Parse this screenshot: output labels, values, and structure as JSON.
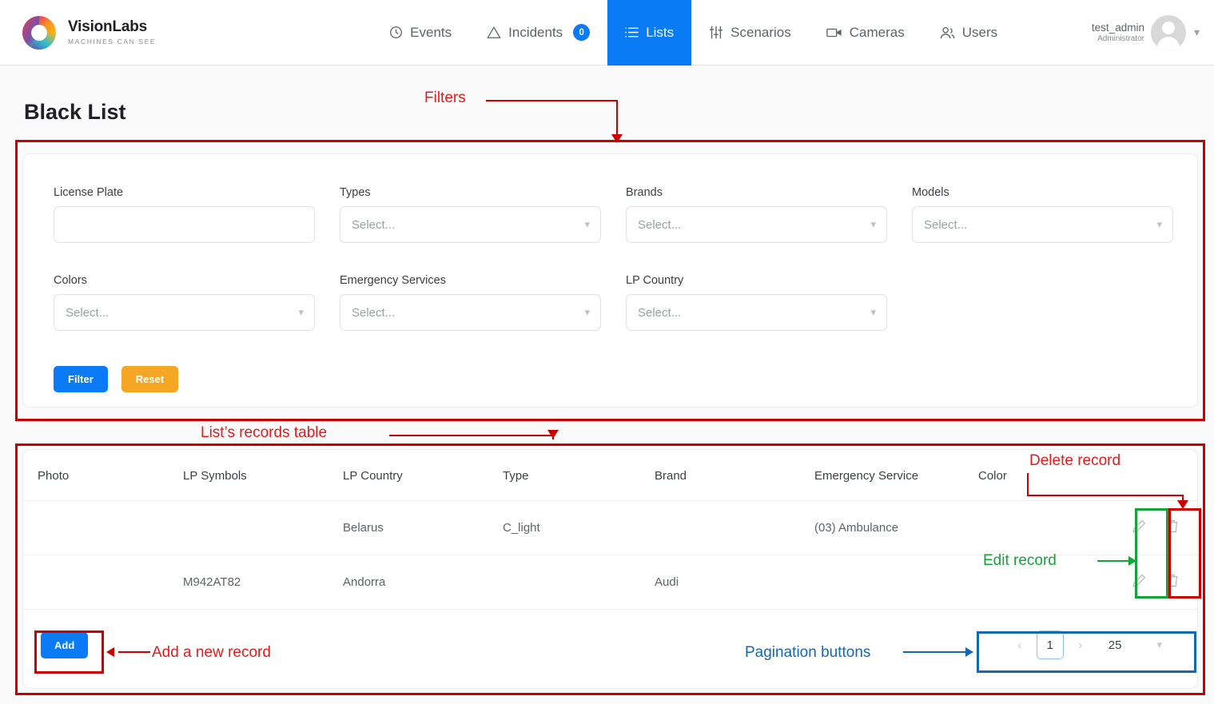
{
  "brand": {
    "name": "VisionLabs",
    "tagline": "MACHINES CAN SEE"
  },
  "nav": {
    "items": [
      {
        "label": "Events",
        "icon": "clock-icon",
        "active": false
      },
      {
        "label": "Incidents",
        "icon": "warning-triangle-icon",
        "active": false,
        "badge": "0"
      },
      {
        "label": "Lists",
        "icon": "list-icon",
        "active": true
      },
      {
        "label": "Scenarios",
        "icon": "sliders-icon",
        "active": false
      },
      {
        "label": "Cameras",
        "icon": "video-camera-icon",
        "active": false
      },
      {
        "label": "Users",
        "icon": "users-icon",
        "active": false
      }
    ],
    "user": {
      "name": "test_admin",
      "role": "Administrator"
    }
  },
  "page": {
    "title": "Black List"
  },
  "filters": {
    "license_plate": {
      "label": "License Plate",
      "value": "",
      "placeholder": ""
    },
    "types": {
      "label": "Types",
      "value": "Select..."
    },
    "brands": {
      "label": "Brands",
      "value": "Select..."
    },
    "models": {
      "label": "Models",
      "value": "Select..."
    },
    "colors": {
      "label": "Colors",
      "value": "Select..."
    },
    "emergency_services": {
      "label": "Emergency Services",
      "value": "Select..."
    },
    "lp_country": {
      "label": "LP Country",
      "value": "Select..."
    },
    "filter_button": "Filter",
    "reset_button": "Reset"
  },
  "table": {
    "columns": [
      "Photo",
      "LP Symbols",
      "LP Country",
      "Type",
      "Brand",
      "Emergency Service",
      "Color"
    ],
    "rows": [
      {
        "photo": "",
        "lp_symbols": "",
        "lp_country": "Belarus",
        "type": "C_light",
        "brand": "",
        "emergency_service": "(03) Ambulance",
        "color": ""
      },
      {
        "photo": "",
        "lp_symbols": "M942AT82",
        "lp_country": "Andorra",
        "type": "",
        "brand": "Audi",
        "emergency_service": "",
        "color": ""
      }
    ]
  },
  "footer": {
    "add_button": "Add",
    "pagination": {
      "prev": "‹",
      "current_page": "1",
      "next": "›",
      "page_size": "25"
    }
  },
  "annotations": {
    "filters": "Filters",
    "records_table": "List’s records table",
    "delete_record": "Delete record",
    "edit_record": "Edit record",
    "add_record": "Add a new record",
    "pagination": "Pagination buttons"
  },
  "colors": {
    "accent": "#0b7bf5",
    "reset": "#f5a623",
    "annotation_red": "#cc0000",
    "annotation_green": "#13a538",
    "annotation_blue": "#1469b4"
  }
}
